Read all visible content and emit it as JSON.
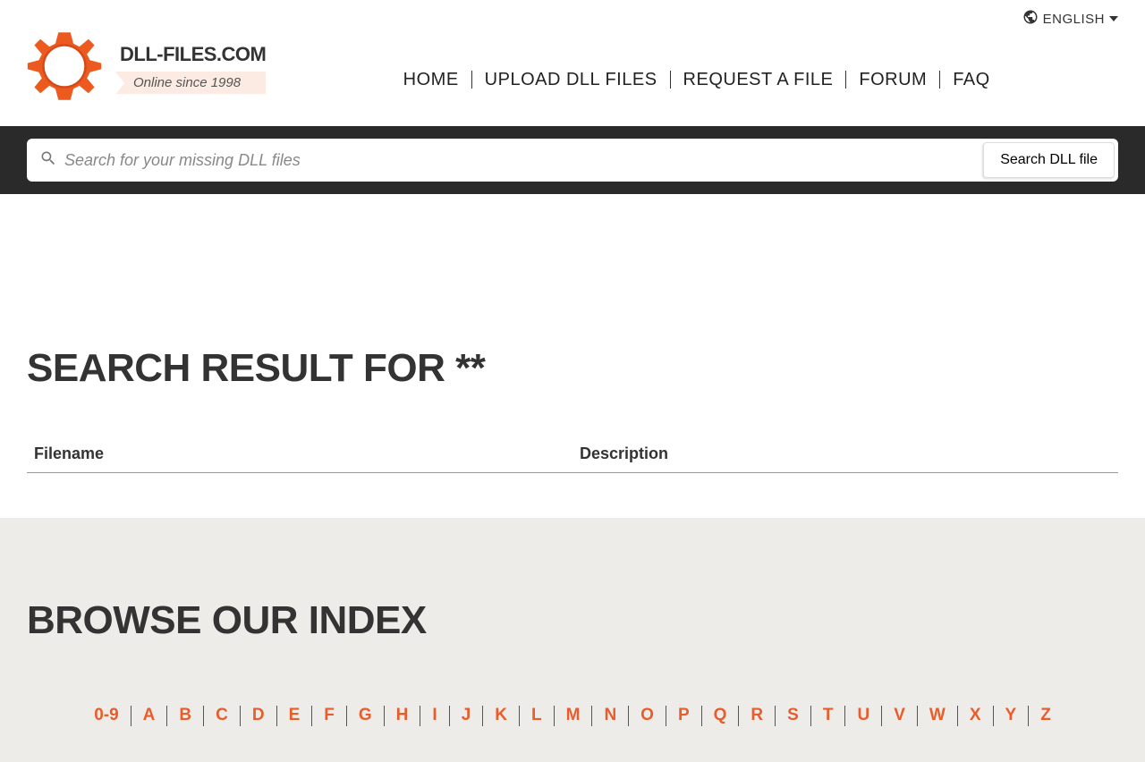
{
  "language": {
    "label": "ENGLISH"
  },
  "brand": {
    "title": "DLL-FILES.COM",
    "tagline": "Online since 1998"
  },
  "nav": {
    "items": [
      "HOME",
      "UPLOAD DLL FILES",
      "REQUEST A FILE",
      "FORUM",
      "FAQ"
    ]
  },
  "search": {
    "placeholder": "Search for your missing DLL files",
    "button_label": "Search DLL file"
  },
  "results": {
    "title": "SEARCH RESULT FOR **",
    "columns": [
      "Filename",
      "Description"
    ],
    "rows": []
  },
  "browse": {
    "title": "BROWSE OUR INDEX",
    "letters": [
      "0-9",
      "A",
      "B",
      "C",
      "D",
      "E",
      "F",
      "G",
      "H",
      "I",
      "J",
      "K",
      "L",
      "M",
      "N",
      "O",
      "P",
      "Q",
      "R",
      "S",
      "T",
      "U",
      "V",
      "W",
      "X",
      "Y",
      "Z"
    ]
  }
}
